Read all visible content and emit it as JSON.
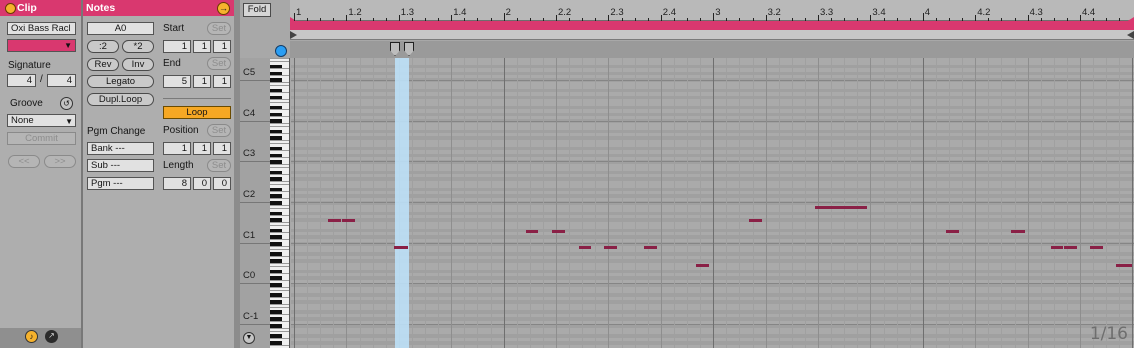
{
  "clip": {
    "title": "Clip",
    "name": "Oxi Bass Racl",
    "signature_label": "Signature",
    "sig_num": "4",
    "sig_sep": "/",
    "sig_den": "4",
    "groove_label": "Groove",
    "groove_value": "None",
    "commit": "Commit",
    "nav_prev": "<<",
    "nav_next": ">>"
  },
  "notes": {
    "title": "Notes",
    "pitch": "A0",
    "halve": ":2",
    "double": "*2",
    "rev": "Rev",
    "inv": "Inv",
    "legato": "Legato",
    "dupl_loop": "Dupl.Loop",
    "pgm_change": "Pgm Change",
    "bank": "Bank ---",
    "sub": "Sub ---",
    "pgm": "Pgm ---",
    "start_label": "Start",
    "start_values": [
      "1",
      "1",
      "1"
    ],
    "end_label": "End",
    "end_values": [
      "5",
      "1",
      "1"
    ],
    "set": "Set",
    "loop": "Loop",
    "position_label": "Position",
    "position_values": [
      "1",
      "1",
      "1"
    ],
    "length_label": "Length",
    "length_values": [
      "8",
      "0",
      "0"
    ]
  },
  "editor": {
    "fold": "Fold",
    "grid": "1/16",
    "ruler_labels": [
      "1",
      "1.2",
      "1.3",
      "1.4",
      "2",
      "2.2",
      "2.3",
      "2.4",
      "3",
      "3.2",
      "3.3",
      "3.4",
      "4",
      "4.2",
      "4.3",
      "4.4"
    ],
    "octave_labels": [
      "C5",
      "C4",
      "C3",
      "C2",
      "C1",
      "C0",
      "C-1"
    ]
  },
  "colors": {
    "accent": "#d9386f",
    "note": "#8a2046",
    "loop_button": "#f6a824",
    "playhead": "#bde0f7"
  }
}
